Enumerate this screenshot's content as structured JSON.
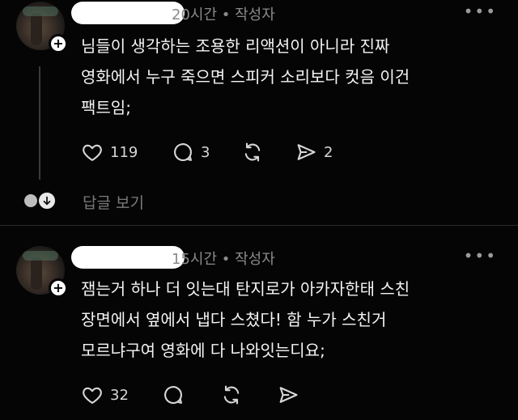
{
  "posts": [
    {
      "time": "20시간",
      "sep": "•",
      "author_tag": "작성자",
      "more": "•••",
      "lines": [
        "님들이 생각하는 조용한 리액션이 아니라 진짜",
        "영화에서 누구 죽으면 스피커 소리보다 컷음 이건",
        "팩트임;"
      ],
      "likes": "119",
      "comments": "3",
      "reposts": "",
      "shares": "2",
      "view_replies": "답글 보기"
    },
    {
      "time": "15시간",
      "sep": "•",
      "author_tag": "작성자",
      "more": "•••",
      "lines": [
        "잼는거 하나 더 잇는대 탄지로가 아카자한태 스친",
        "장면에서 옆에서 냅다 스쳤다! 함 누가 스친거",
        "모르냐구여 영화에 다 나와잇는디요;"
      ],
      "likes": "32",
      "comments": "",
      "reposts": "",
      "shares": ""
    }
  ],
  "follow_badge": "+",
  "icons": {
    "like": "heart-icon",
    "comment": "comment-icon",
    "repost": "repost-icon",
    "share": "share-icon",
    "more": "more-icon"
  }
}
